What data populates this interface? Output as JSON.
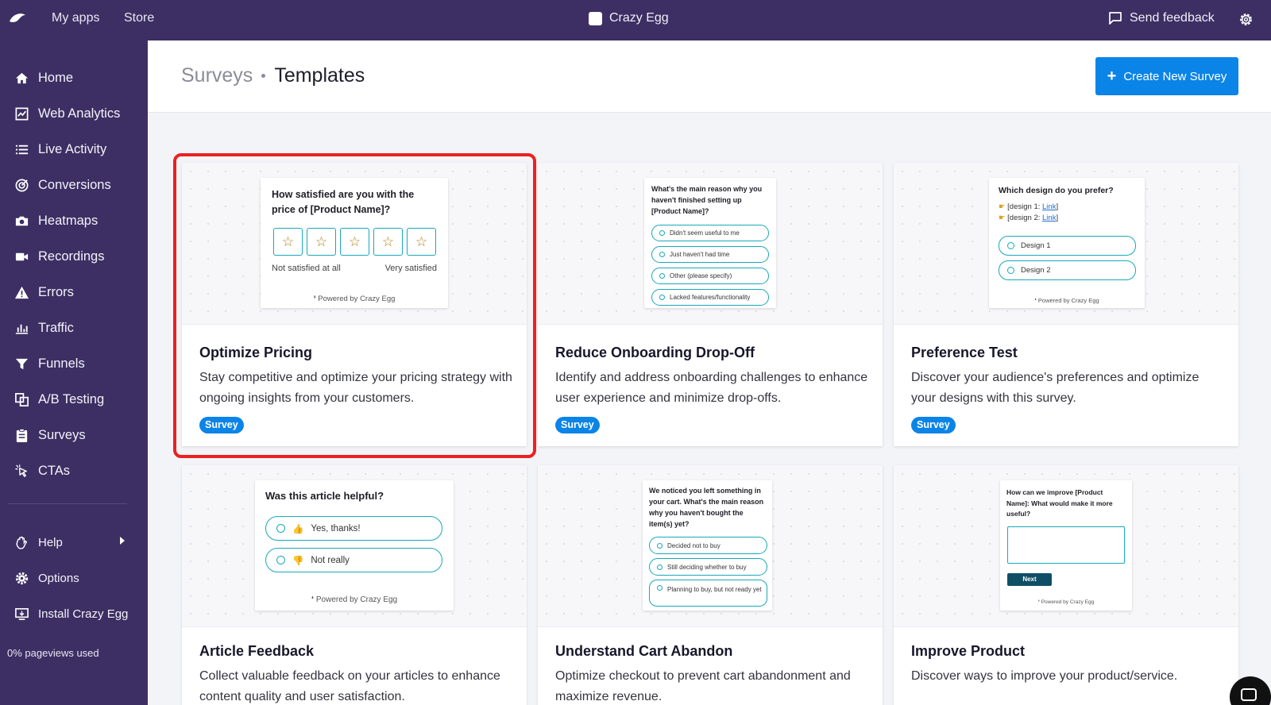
{
  "topbar": {
    "my_apps": "My apps",
    "store": "Store",
    "app_title": "Crazy Egg",
    "send_feedback": "Send feedback"
  },
  "sidebar": {
    "items": [
      {
        "label": "Home",
        "icon": "home-icon"
      },
      {
        "label": "Web Analytics",
        "icon": "chart-icon"
      },
      {
        "label": "Live Activity",
        "icon": "list-icon"
      },
      {
        "label": "Conversions",
        "icon": "target-icon"
      },
      {
        "label": "Heatmaps",
        "icon": "camera-icon"
      },
      {
        "label": "Recordings",
        "icon": "video-icon"
      },
      {
        "label": "Errors",
        "icon": "warning-icon"
      },
      {
        "label": "Traffic",
        "icon": "bar-chart-icon"
      },
      {
        "label": "Funnels",
        "icon": "funnel-icon"
      },
      {
        "label": "A/B Testing",
        "icon": "ab-icon"
      },
      {
        "label": "Surveys",
        "icon": "clipboard-icon"
      },
      {
        "label": "CTAs",
        "icon": "pointer-icon"
      }
    ],
    "help": "Help",
    "options": "Options",
    "install": "Install Crazy Egg",
    "pageviews": "0% pageviews used"
  },
  "header": {
    "crumb_parent": "Surveys",
    "crumb_current": "Templates",
    "create_button": "Create New Survey"
  },
  "cards": [
    {
      "title": "Optimize Pricing",
      "desc": "Stay competitive and optimize your pricing strategy with ongoing insights from your customers.",
      "tag": "Survey",
      "preview": {
        "question": "How satisfied are you with the price of [Product Name]?",
        "low_label": "Not satisfied at all",
        "high_label": "Very satisfied",
        "powered": "Powered by Crazy Egg"
      }
    },
    {
      "title": "Reduce Onboarding Drop-Off",
      "desc": "Identify and address onboarding challenges to enhance user experience and minimize drop-offs.",
      "tag": "Survey",
      "preview": {
        "question": "What's the main reason why you haven't finished setting up [Product Name]?",
        "options": [
          "Didn't seem useful to me",
          "Just haven't had time",
          "Other (please specify)",
          "Lacked features/functionality"
        ]
      }
    },
    {
      "title": "Preference Test",
      "desc": "Discover your audience's preferences and optimize your designs with this survey.",
      "tag": "Survey",
      "preview": {
        "question": "Which design do you prefer?",
        "line1_prefix": "[design 1: ",
        "line1_link": "Link",
        "line1_suffix": "]",
        "line2_prefix": "[design 2: ",
        "line2_link": "Link",
        "line2_suffix": "]",
        "options": [
          "Design 1",
          "Design 2"
        ],
        "powered": "Powered by Crazy Egg"
      }
    },
    {
      "title": "Article Feedback",
      "desc": "Collect valuable feedback on your articles to enhance content quality and user satisfaction.",
      "preview": {
        "question": "Was this article helpful?",
        "options": [
          "Yes, thanks!",
          "Not really"
        ],
        "powered": "Powered by Crazy Egg"
      }
    },
    {
      "title": "Understand Cart Abandon",
      "desc": "Optimize checkout to prevent cart abandonment and maximize revenue.",
      "preview": {
        "question": "We noticed you left something in your cart. What's the main reason why you haven't bought the item(s) yet?",
        "options": [
          "Decided not to buy",
          "Still deciding whether to buy",
          "Planning to buy, but not ready yet"
        ]
      }
    },
    {
      "title": "Improve Product",
      "desc": "Discover ways to improve your product/service.",
      "preview": {
        "question": "How can we improve [Product Name]: What would make it more useful?",
        "next": "Next",
        "powered": "Powered by Crazy Egg"
      }
    }
  ],
  "colors": {
    "nav_bg": "#3d2f63",
    "accent": "#0b84e8",
    "selection": "#ec2121",
    "option_border": "#17a9b8"
  }
}
